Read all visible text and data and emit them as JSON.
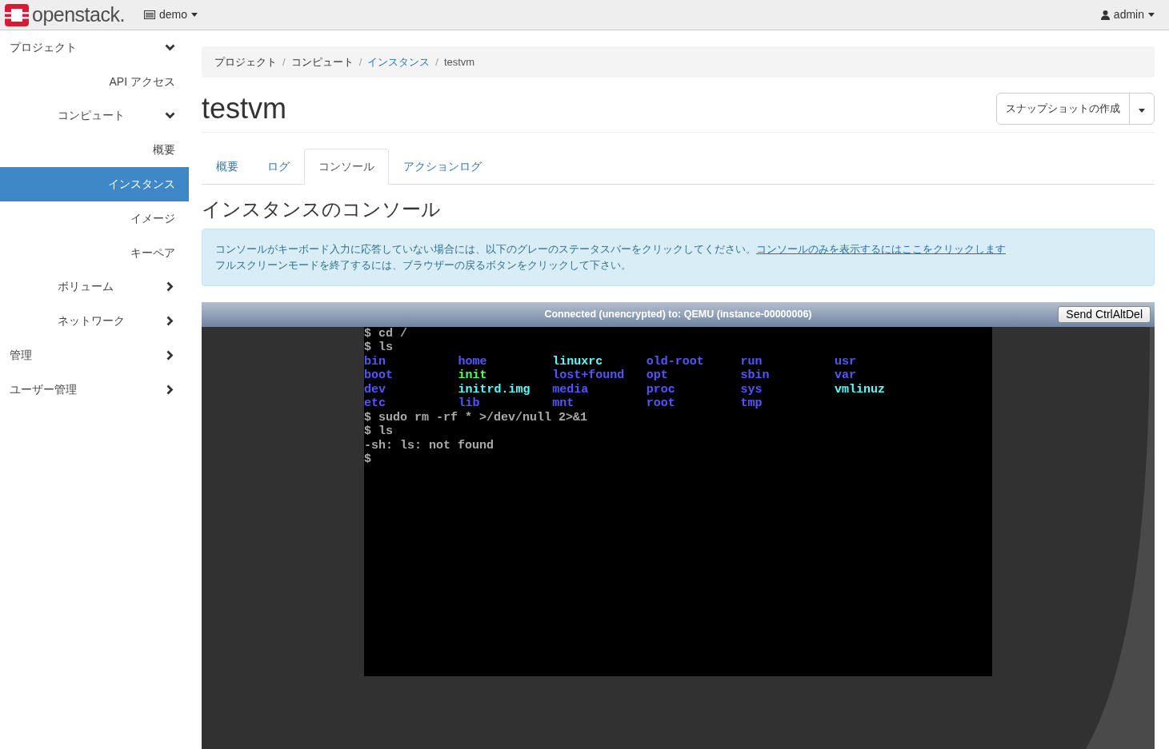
{
  "navbar": {
    "logo": "openstack.",
    "project_menu": "demo",
    "user_menu": "admin"
  },
  "sidebar": {
    "items": [
      {
        "kind": "group",
        "label": "プロジェクト",
        "expanded": true,
        "children": [
          {
            "kind": "link",
            "label": "API アクセス",
            "selected": false
          },
          {
            "kind": "group",
            "label": "コンピュート",
            "expanded": true,
            "children": [
              {
                "kind": "link",
                "label": "概要",
                "selected": false
              },
              {
                "kind": "link",
                "label": "インスタンス",
                "selected": true
              },
              {
                "kind": "link",
                "label": "イメージ",
                "selected": false
              },
              {
                "kind": "link",
                "label": "キーペア",
                "selected": false
              }
            ]
          },
          {
            "kind": "group",
            "label": "ボリューム",
            "expanded": false
          },
          {
            "kind": "group",
            "label": "ネットワーク",
            "expanded": false
          }
        ]
      },
      {
        "kind": "group",
        "label": "管理",
        "expanded": false
      },
      {
        "kind": "group",
        "label": "ユーザー管理",
        "expanded": false
      }
    ]
  },
  "breadcrumb": {
    "separator": "/",
    "items": [
      {
        "kind": "text",
        "label": "プロジェクト"
      },
      {
        "kind": "text",
        "label": "コンピュート"
      },
      {
        "kind": "link",
        "label": "インスタンス"
      },
      {
        "kind": "current",
        "label": "testvm"
      }
    ]
  },
  "page_title": "testvm",
  "snapshot_button": "スナップショットの作成",
  "tabs": [
    {
      "label": "概要",
      "selected": false
    },
    {
      "label": "ログ",
      "selected": false
    },
    {
      "label": "コンソール",
      "selected": true
    },
    {
      "label": "アクションログ",
      "selected": false
    }
  ],
  "section_title": "インスタンスのコンソール",
  "alert": {
    "text": "コンソールがキーボード入力に応答していない場合には、以下のグレーのステータスバーをクリックしてください。",
    "link": "コンソールのみを表示するにはここをクリックします",
    "text_2": "フルスクリーンモードを終了するには、ブラウザーの戻るボタンをクリックして下さい。"
  },
  "console": {
    "status": "Connected (unencrypted) to: QEMU (instance-00000006)",
    "button": "Send CtrlAltDel",
    "lines": [
      {
        "kind": "text",
        "text": "$ cd /"
      },
      {
        "kind": "text",
        "text": "$ ls"
      },
      {
        "kind": "files",
        "entries": [
          {
            "text": "bin",
            "color": "#5555ff"
          },
          {
            "text": "home",
            "color": "#5555ff"
          },
          {
            "text": "linuxrc",
            "color": "#55ffff"
          },
          {
            "text": "old-root",
            "color": "#5555ff"
          },
          {
            "text": "run",
            "color": "#5555ff"
          },
          {
            "text": "usr",
            "color": "#5555ff"
          }
        ]
      },
      {
        "kind": "files",
        "entries": [
          {
            "text": "boot",
            "color": "#5555ff"
          },
          {
            "text": "init",
            "color": "#55ff55"
          },
          {
            "text": "lost+found",
            "color": "#5555ff"
          },
          {
            "text": "opt",
            "color": "#5555ff"
          },
          {
            "text": "sbin",
            "color": "#5555ff"
          },
          {
            "text": "var",
            "color": "#5555ff"
          }
        ]
      },
      {
        "kind": "files",
        "entries": [
          {
            "text": "dev",
            "color": "#5555ff"
          },
          {
            "text": "initrd.img",
            "color": "#55ffff"
          },
          {
            "text": "media",
            "color": "#5555ff"
          },
          {
            "text": "proc",
            "color": "#5555ff"
          },
          {
            "text": "sys",
            "color": "#5555ff"
          },
          {
            "text": "vmlinuz",
            "color": "#55ffff"
          }
        ]
      },
      {
        "kind": "files",
        "entries": [
          {
            "text": "etc",
            "color": "#5555ff"
          },
          {
            "text": "lib",
            "color": "#5555ff"
          },
          {
            "text": "mnt",
            "color": "#5555ff"
          },
          {
            "text": "root",
            "color": "#5555ff"
          },
          {
            "text": "tmp",
            "color": "#5555ff"
          }
        ]
      },
      {
        "kind": "text",
        "text": "$ sudo rm -rf * >/dev/null 2>&1"
      },
      {
        "kind": "text",
        "text": "$ ls"
      },
      {
        "kind": "text",
        "text": "-sh: ls: not found"
      },
      {
        "kind": "text",
        "text": "$"
      }
    ]
  }
}
